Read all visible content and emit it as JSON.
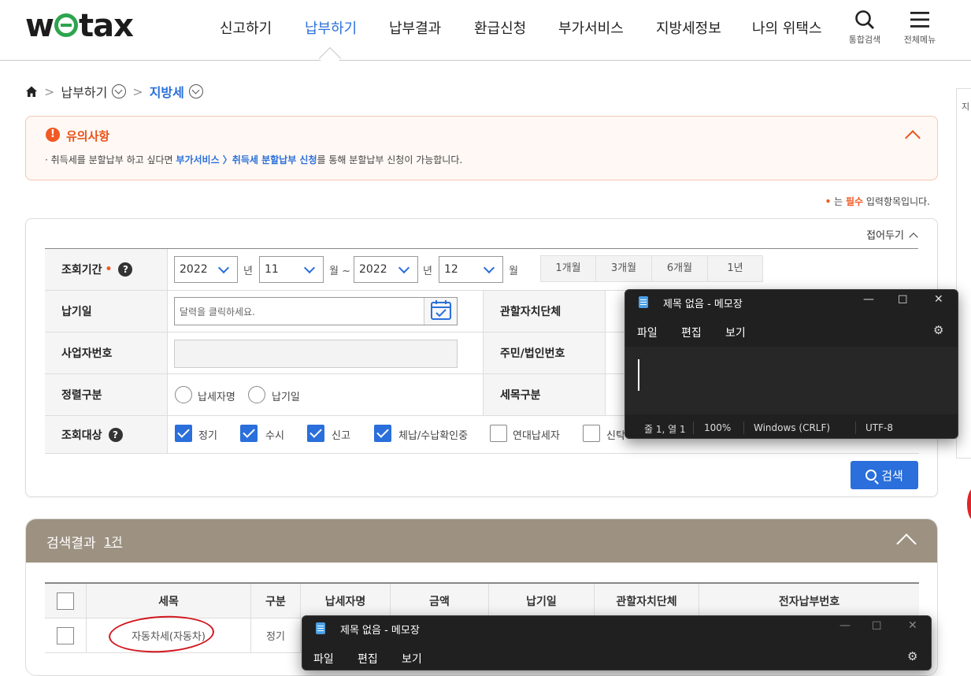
{
  "header": {
    "logo": "wetax",
    "nav": [
      "신고하기",
      "납부하기",
      "납부결과",
      "환급신청",
      "부가서비스",
      "지방세정보",
      "나의 위택스"
    ],
    "active_nav": "납부하기",
    "search_label": "통합검색",
    "menu_label": "전체메뉴"
  },
  "breadcrumb": {
    "level1": "납부하기",
    "level2": "지방세"
  },
  "notice": {
    "title": "유의사항",
    "text_prefix": "· 취득세를 분할납부 하고 싶다면 ",
    "text_link": "부가서비스 〉취득세 분할납부 신청",
    "text_suffix": "를 통해 분할납부 신청이 가능합니다."
  },
  "required_note": {
    "prefix": "는 ",
    "required": "필수",
    "suffix": " 입력항목입니다."
  },
  "search": {
    "fold_label": "접어두기",
    "period_label": "조회기간",
    "from_year": "2022",
    "from_month": "11",
    "to_year": "2022",
    "to_month": "12",
    "unit_year": "년",
    "unit_month_from": "월 ~",
    "unit_month_to": "월",
    "period_buttons": [
      "1개월",
      "3개월",
      "6개월",
      "1년"
    ],
    "pay_date_label": "납기일",
    "pay_date_placeholder": "달력을 클릭하세요.",
    "local_gov_label": "관할자치단체",
    "biz_no_label": "사업자번호",
    "resident_no_label": "주민/법인번호",
    "sort_label": "정렬구분",
    "sort_options": [
      "납세자명",
      "납기일"
    ],
    "tax_item_label": "세목구분",
    "target_label": "조회대상",
    "targets": [
      {
        "label": "정기",
        "checked": true
      },
      {
        "label": "수시",
        "checked": true
      },
      {
        "label": "신고",
        "checked": true
      },
      {
        "label": "체납/수납확인중",
        "checked": true
      },
      {
        "label": "연대납세자",
        "checked": false
      },
      {
        "label": "신탁",
        "checked": false
      }
    ],
    "search_button": "검색"
  },
  "results": {
    "title": "검색결과",
    "count": "1건",
    "columns": [
      "세목",
      "구분",
      "납세자명",
      "금액",
      "납기일",
      "관할자치단체",
      "전자납부번호"
    ],
    "rows": [
      {
        "tax": "자동차세(자동차)",
        "type": "정기"
      }
    ]
  },
  "notepad1": {
    "title": "제목 없음 - 메모장",
    "menu": [
      "파일",
      "편집",
      "보기"
    ],
    "status": {
      "position": "줄 1, 열 1",
      "zoom": "100%",
      "eol": "Windows (CRLF)",
      "encoding": "UTF-8"
    }
  },
  "notepad2": {
    "title": "제목 없음 - 메모장",
    "menu": [
      "파일",
      "편집",
      "보기"
    ]
  },
  "side_tab": "지"
}
